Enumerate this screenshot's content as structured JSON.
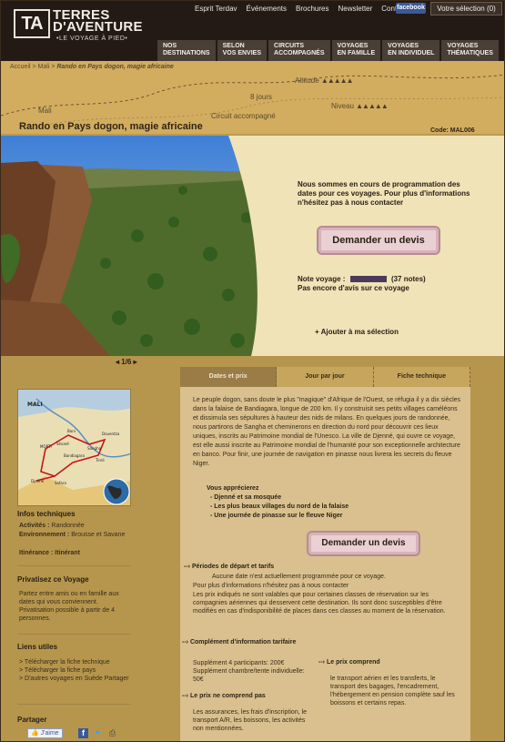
{
  "header": {
    "logo_mark": "TA",
    "logo_line1": "TERRES",
    "logo_line2": "D'AVENTURE",
    "logo_sub": "•LE VOYAGE À PIED•",
    "top_links": [
      "Esprit Terdav",
      "Événements",
      "Brochures",
      "Newsletter",
      "Contacts"
    ],
    "facebook": "facebook",
    "selection": "Votre sélection (0)",
    "nav": [
      [
        "NOS",
        "DESTINATIONS"
      ],
      [
        "SELON",
        "VOS ENVIES"
      ],
      [
        "CIRCUITS",
        "ACCOMPAGNÉS"
      ],
      [
        "VOYAGES",
        "EN FAMILLE"
      ],
      [
        "VOYAGES",
        "EN INDIVIDUEL"
      ],
      [
        "VOYAGES",
        "THÉMATIQUES"
      ]
    ]
  },
  "breadcrumb": {
    "path": "Accueil > Mali >",
    "current": "Rando en Pays dogon, magie africaine"
  },
  "trip": {
    "altitude": "Altitude",
    "duration": "8 jours",
    "country": "Mali",
    "niveau": "Niveau",
    "type": "Circuit accompagné"
  },
  "title": "Rando en Pays dogon, magie africaine",
  "code": "Code: MAL006",
  "promo": "Nous sommes en cours de programmation des dates pour ces voyages. Pour plus d'informations n'hésitez pas à nous contacter",
  "devis_label": "Demander un devis",
  "note_label": "Note voyage :",
  "note_count": "(37 notes)",
  "avis": "Pas encore d'avis sur ce voyage",
  "ajout": "+ Ajouter à ma sélection",
  "pager": "1/6",
  "tabs": [
    "Dates et prix",
    "Jour par jour",
    "Fiche technique"
  ],
  "description": "Le peuple dogon, sans doute le plus \"magique\" d'Afrique de l'Ouest, se réfugia il y a dix siècles dans la falaise de Bandiagara, longue de 200 km. Il y construisit ses petits villages caméléons et dissimula ses sépultures à hauteur des nids de milans. En quelques jours de randonnée, nous partirons de Sangha et cheminerons en direction du nord pour découvrir ces lieux uniques, inscrits au Patrimoine mondial de l'Unesco. La ville de Djenné, qui ouvre ce voyage, est elle aussi inscrite au Patrimoine mondial de l'humanité pour son exceptionnelle architecture en banco. Pour finir, une journée de navigation en pinasse nous livrera les secrets du fleuve Niger.",
  "apprecierez": {
    "heading": "Vous apprécierez",
    "items": [
      "- Djenné et sa mosquée",
      "- Les plus beaux villages du nord de la falaise",
      "- Une journée de pinasse sur le fleuve Niger"
    ]
  },
  "periodes": {
    "heading": "Périodes de départ et tarifs",
    "line1": "Aucune date n'est actuellement programmée pour ce voyage.",
    "line2": "Pour plus d'informations n'hésitez pas à nous contacter",
    "line3": "Les prix indiqués ne sont valables que pour certaines classes de réservation sur les compagnies aériennes qui desservent cette destination. Ils sont donc susceptibles d'être modifiés en cas d'indisponibilité de places dans ces classes au moment de la réservation."
  },
  "complement": {
    "heading": "Complément d'information tarifaire",
    "text": "Supplément 4 participants: 200€ Supplément chambre/tente individuelle: 50€"
  },
  "comprend": {
    "heading": "Le prix comprend",
    "text": "le transport aérien et les transferts, le transport des bagages, l'encadrement, l'hébergement en pension complète sauf les boissons et certains repas."
  },
  "ne_comprend": {
    "heading": "Le prix ne comprend pas",
    "text": "Les assurances, les frais d'inscription, le transport A/R, les boissons, les activités non mentionnées."
  },
  "map": {
    "country": "MALI",
    "places": [
      "Mopti",
      "Sévaré",
      "Bandiagara",
      "Sangha",
      "Djenné",
      "Sofara",
      "Bamako",
      "Boni",
      "Douentza",
      "Tireli"
    ]
  },
  "infos": {
    "heading": "Infos techniques",
    "activites_label": "Activités :",
    "activites": "Randonnée",
    "environnement_label": "Environnement :",
    "environnement": "Brousse et Savane",
    "itinerance": "Itinérance : Itinérant"
  },
  "privatisez": {
    "heading": "Privatisez ce Voyage",
    "text": "Partez entre amis ou en famille aux dates qui vous conviennent. Privatisation possible à partir de 4 personnes."
  },
  "liens": {
    "heading": "Liens utiles",
    "items": [
      "> Télécharger la fiche technique",
      "> Télécharger la fiche pays",
      "> D'autres voyages en Suède Partager"
    ]
  },
  "partager": {
    "heading": "Partager",
    "like": "J'aime"
  },
  "colors": {
    "dark": "#241a15",
    "parchment": "#d2ad5f",
    "accent_pink": "#ead0d3"
  }
}
